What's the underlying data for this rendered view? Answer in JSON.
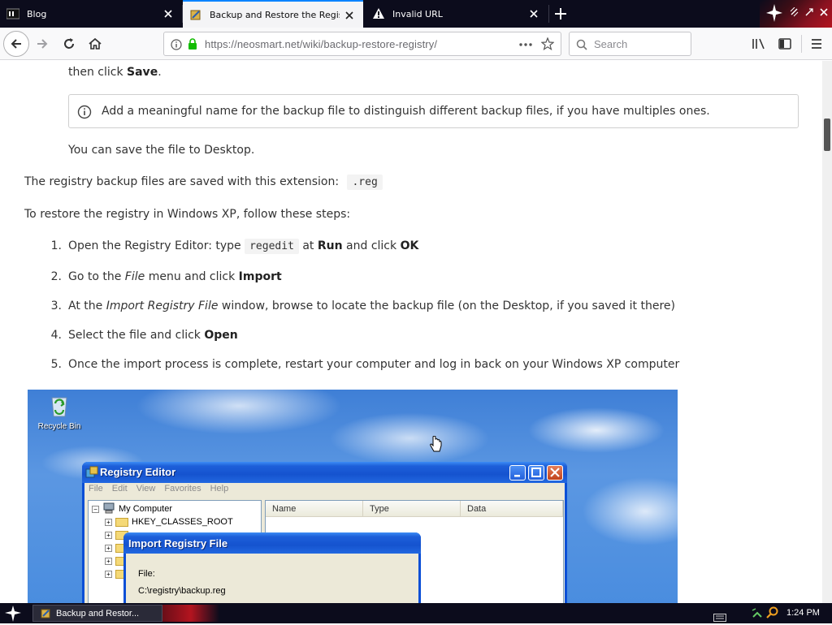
{
  "browser": {
    "tabs": [
      {
        "label": "Blog",
        "active": false
      },
      {
        "label": "Backup and Restore the Registry",
        "active": true
      },
      {
        "label": "Invalid URL",
        "active": false
      }
    ],
    "url": "https://neosmart.net/wiki/backup-restore-registry/",
    "search_placeholder": "Search"
  },
  "content": {
    "line_then_click": "then click ",
    "save_word": "Save",
    "note_text": "Add a meaningful name for the backup file to distinguish different backup files, if you have multiples ones.",
    "save_desktop": "You can save the file to Desktop.",
    "ext_intro": "The registry backup files are saved with this extension:",
    "ext_code": ".reg",
    "restore_intro": "To restore the registry in Windows XP, follow these steps:",
    "steps": [
      {
        "num": "1.",
        "a": "Open the Registry Editor: type ",
        "code": "regedit",
        "b": " at ",
        "bold1": "Run",
        "c": " and click ",
        "bold2": "OK"
      },
      {
        "num": "2.",
        "a": "Go to the ",
        "italic": "File",
        "b": " menu and click ",
        "bold": "Import"
      },
      {
        "num": "3.",
        "a": "At the ",
        "italic": "Import Registry File",
        "b": " window, browse to locate the backup file (on the Desktop, if you saved it there)"
      },
      {
        "num": "4.",
        "a": "Select the file and click ",
        "bold": "Open"
      },
      {
        "num": "5.",
        "a": "Once the import process is complete, restart your computer and log in back on your Windows XP computer"
      }
    ]
  },
  "screenshot": {
    "recycle_label": "Recycle Bin",
    "regedit_title": "Registry Editor",
    "menu": [
      "File",
      "Edit",
      "View",
      "Favorites",
      "Help"
    ],
    "tree_root": "My Computer",
    "tree_first": "HKEY_CLASSES_ROOT",
    "columns": [
      "Name",
      "Type",
      "Data"
    ],
    "import_title": "Import Registry File",
    "file_label": "File:",
    "file_path": "C:\\registry\\backup.reg"
  },
  "taskbar": {
    "task_label": "Backup and Restor...",
    "clock": "1:24 PM"
  }
}
